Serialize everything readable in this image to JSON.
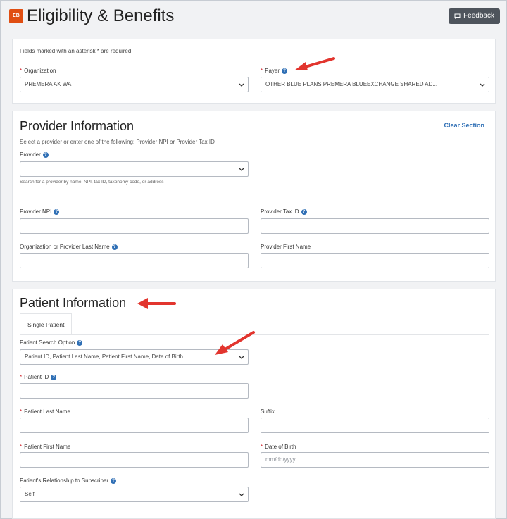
{
  "header": {
    "logo_text": "EB",
    "title": "Eligibility & Benefits",
    "feedback_label": "Feedback"
  },
  "top": {
    "required_note": "Fields marked with an asterisk * are required.",
    "organization_label": "Organization",
    "organization_value": "PREMERA AK WA",
    "payer_label": "Payer",
    "payer_value": "OTHER BLUE PLANS PREMERA BLUEEXCHANGE SHARED AD..."
  },
  "provider": {
    "title": "Provider Information",
    "clear_label": "Clear Section",
    "instructions": "Select a provider or enter one of the following: Provider NPI or Provider Tax ID",
    "provider_label": "Provider",
    "provider_hint": "Search for a provider by name, NPI, tax ID, taxonomy code, or address",
    "npi_label": "Provider NPI",
    "tax_id_label": "Provider Tax ID",
    "last_name_label": "Organization or Provider Last Name",
    "first_name_label": "Provider First Name"
  },
  "patient": {
    "title": "Patient Information",
    "tab_label": "Single Patient",
    "search_option_label": "Patient Search Option",
    "search_option_value": "Patient ID, Patient Last Name, Patient First Name, Date of Birth",
    "patient_id_label": "Patient ID",
    "last_name_label": "Patient Last Name",
    "suffix_label": "Suffix",
    "first_name_label": "Patient First Name",
    "dob_label": "Date of Birth",
    "dob_placeholder": "mm/dd/yyyy",
    "relationship_label": "Patient's Relationship to Subscriber",
    "relationship_value": "Self"
  },
  "colors": {
    "accent": "#2f6fb5",
    "required": "#d0252d",
    "annotation_arrow": "#e2352e",
    "logo": "#e04e12"
  }
}
